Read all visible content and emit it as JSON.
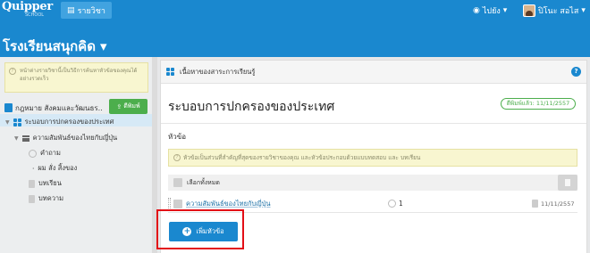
{
  "topbar": {
    "logo": "Quipper",
    "logo_sub": "SCHOOL",
    "subjects_label": "รายวิชา",
    "goto_label": "ไปยัง",
    "user_name": "ปิโนะ สอไส"
  },
  "school": {
    "name": "โรงเรียนสนุกคิด"
  },
  "sidebar": {
    "tip": "หน้าต่างรายวิชานี้เป็นวิธีการค้นหาหัวข้อของคุณได้อย่างรวดเร็ว",
    "course_title": "กฎหมาย สังคมและวัฒนธร..",
    "publish_label": "ตีพิมพ์",
    "items": [
      {
        "label": "ระบอบการปกครองของประเทศ"
      },
      {
        "label": "ความสัมพันธ์ของไทยกับญี่ปุ่น"
      },
      {
        "label": "คำถาม"
      },
      {
        "label": "ผม สั่ง สิ้งของ"
      },
      {
        "label": "บทเรียน"
      },
      {
        "label": "บทความ"
      }
    ]
  },
  "main": {
    "header": "เนื้อหาของสาระการเรียนรู้",
    "title": "ระบอบการปกครองของประเทศ",
    "published": "ตีพิมพ์แล้ว: 11/11/2557",
    "section_label": "หัวข้อ",
    "tip": "หัวข้อเป็นส่วนที่สำคัญที่สุดของรายวิชาของคุณ และหัวข้อประกอบด้วยแบบทดสอบ และ บทเรียน",
    "select_all": "เลือกทั้งหมด",
    "topics": [
      {
        "name": "ความสัมพันธ์ของไทยกับญี่ปุ่น",
        "count": "1",
        "date": "11/11/2557"
      }
    ],
    "add_topic": "เพิ่มหัวข้อ"
  },
  "colors": {
    "primary": "#1a88cf",
    "success": "#4cae4c",
    "highlight": "#e30f16"
  }
}
